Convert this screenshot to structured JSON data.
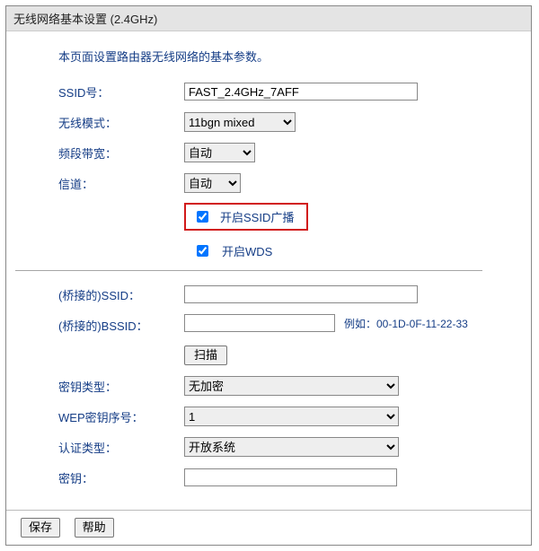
{
  "header": {
    "title": "无线网络基本设置  (2.4GHz)"
  },
  "intro": "本页面设置路由器无线网络的基本参数。",
  "fields": {
    "ssid": {
      "label": "SSID号：",
      "value": "FAST_2.4GHz_7AFF"
    },
    "mode": {
      "label": "无线模式：",
      "value": "11bgn mixed"
    },
    "bandwidth": {
      "label": "频段带宽：",
      "value": "自动"
    },
    "channel": {
      "label": "信道：",
      "value": "自动"
    },
    "ssid_broadcast": {
      "label": "开启SSID广播",
      "checked": true
    },
    "wds": {
      "label": "开启WDS",
      "checked": true
    },
    "bridge_ssid": {
      "label": "(桥接的)SSID：",
      "value": ""
    },
    "bridge_bssid": {
      "label": "(桥接的)BSSID：",
      "value": "",
      "hint": "例如：00-1D-0F-11-22-33"
    },
    "scan_btn": {
      "label": "扫描"
    },
    "enc_type": {
      "label": "密钥类型：",
      "value": "无加密"
    },
    "wep_index": {
      "label": "WEP密钥序号：",
      "value": "1"
    },
    "auth_type": {
      "label": "认证类型：",
      "value": "开放系统"
    },
    "key": {
      "label": "密钥：",
      "value": ""
    }
  },
  "buttons": {
    "save": "保存",
    "help": "帮助"
  }
}
